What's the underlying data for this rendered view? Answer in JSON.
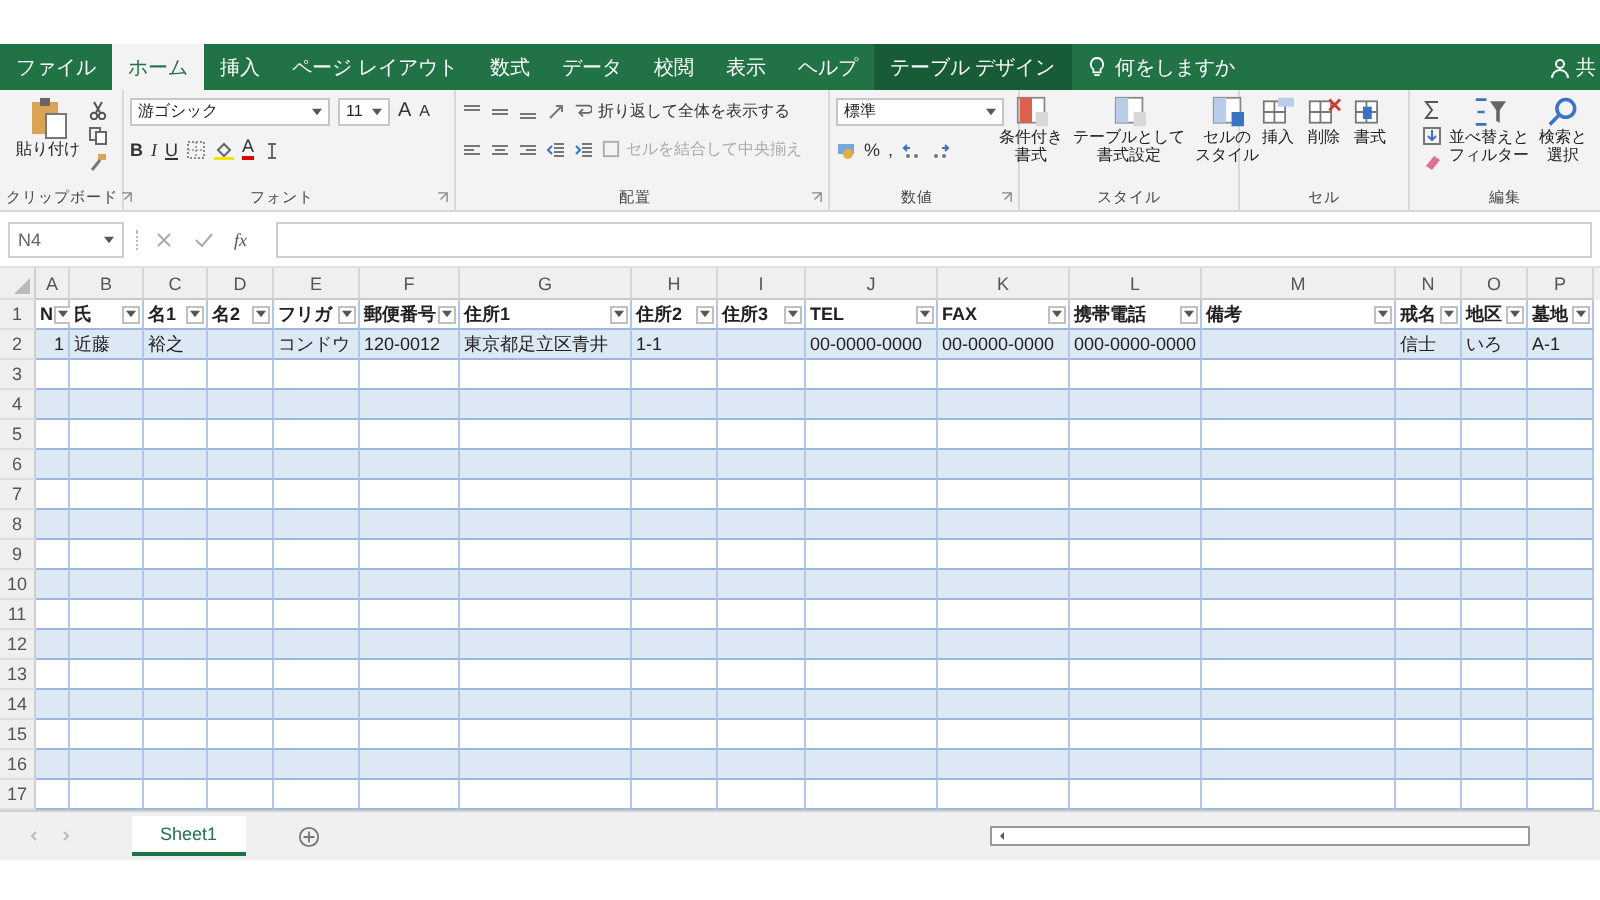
{
  "ribbon_tabs": [
    {
      "label": "ファイル",
      "selected": false,
      "kind": "normal"
    },
    {
      "label": "ホーム",
      "selected": true,
      "kind": "normal"
    },
    {
      "label": "挿入",
      "selected": false,
      "kind": "normal"
    },
    {
      "label": "ページ レイアウト",
      "selected": false,
      "kind": "normal"
    },
    {
      "label": "数式",
      "selected": false,
      "kind": "normal"
    },
    {
      "label": "データ",
      "selected": false,
      "kind": "normal"
    },
    {
      "label": "校閲",
      "selected": false,
      "kind": "normal"
    },
    {
      "label": "表示",
      "selected": false,
      "kind": "normal"
    },
    {
      "label": "ヘルプ",
      "selected": false,
      "kind": "normal"
    },
    {
      "label": "テーブル デザイン",
      "selected": false,
      "kind": "contextual"
    }
  ],
  "tell_me": "何をしますか",
  "share": "共",
  "ribbon": {
    "clipboard": {
      "paste": "貼り付け",
      "label": "クリップボード"
    },
    "font": {
      "name": "游ゴシック",
      "size": "11",
      "grow": "A",
      "shrink": "A",
      "styles": [
        "B",
        "I",
        "U"
      ],
      "color_letter": "A",
      "label": "フォント"
    },
    "alignment": {
      "wrap": "折り返して全体を表示する",
      "merge": {
        "label": "セルを結合して中央揃え",
        "disabled": true
      },
      "label": "配置"
    },
    "number": {
      "format": "標準",
      "percent": "%",
      "comma": ",",
      "label": "数値"
    },
    "styles": {
      "buttons": [
        {
          "lines": [
            "条件付き",
            "書式"
          ]
        },
        {
          "lines": [
            "テーブルとして",
            "書式設定"
          ]
        },
        {
          "lines": [
            "セルの",
            "スタイル"
          ]
        }
      ],
      "label": "スタイル"
    },
    "cells": {
      "buttons": [
        {
          "lines": [
            "挿入"
          ]
        },
        {
          "lines": [
            "削除"
          ]
        },
        {
          "lines": [
            "書式"
          ]
        }
      ],
      "label": "セル"
    },
    "editing": {
      "buttons": [
        {
          "lines": [
            "並べ替えと",
            "フィルター"
          ]
        },
        {
          "lines": [
            "検索と",
            "選択"
          ]
        }
      ],
      "label": "編集"
    }
  },
  "name_box": "N4",
  "fx": "fx",
  "columns": [
    "A",
    "B",
    "C",
    "D",
    "E",
    "F",
    "G",
    "H",
    "I",
    "J",
    "K",
    "L",
    "M",
    "N",
    "O",
    "P"
  ],
  "rows": [
    {
      "number": "1",
      "kind": "header",
      "cells": {
        "A": "N",
        "B": "氏",
        "C": "名1",
        "D": "名2",
        "E": "フリガ",
        "F": "郵便番号",
        "G": "住所1",
        "H": "住所2",
        "I": "住所3",
        "J": "TEL",
        "K": "FAX",
        "L": "携帯電話",
        "M": "備考",
        "N": "戒名",
        "O": "地区",
        "P": "墓地"
      }
    },
    {
      "number": "2",
      "kind": "data",
      "cells": {
        "A": "1",
        "B": "近藤",
        "C": "裕之",
        "E": "コンドウ",
        "F": "120-0012",
        "G": "東京都足立区青井",
        "H": "1-1",
        "J": "00-0000-0000",
        "K": "00-0000-0000",
        "L": "000-0000-0000",
        "N": "信士",
        "O": "いろ",
        "P": "A-1"
      }
    },
    {
      "number": "3",
      "kind": "data"
    },
    {
      "number": "4",
      "kind": "data"
    },
    {
      "number": "5",
      "kind": "data"
    },
    {
      "number": "6",
      "kind": "data"
    },
    {
      "number": "7",
      "kind": "data"
    },
    {
      "number": "8",
      "kind": "data"
    },
    {
      "number": "9",
      "kind": "data"
    },
    {
      "number": "10",
      "kind": "data"
    },
    {
      "number": "11",
      "kind": "data"
    },
    {
      "number": "12",
      "kind": "data"
    },
    {
      "number": "13",
      "kind": "data"
    },
    {
      "number": "14",
      "kind": "data"
    },
    {
      "number": "15",
      "kind": "data"
    },
    {
      "number": "16",
      "kind": "data"
    },
    {
      "number": "17",
      "kind": "data"
    }
  ],
  "sheet_tabs": [
    {
      "label": "Sheet1",
      "selected": true
    }
  ]
}
